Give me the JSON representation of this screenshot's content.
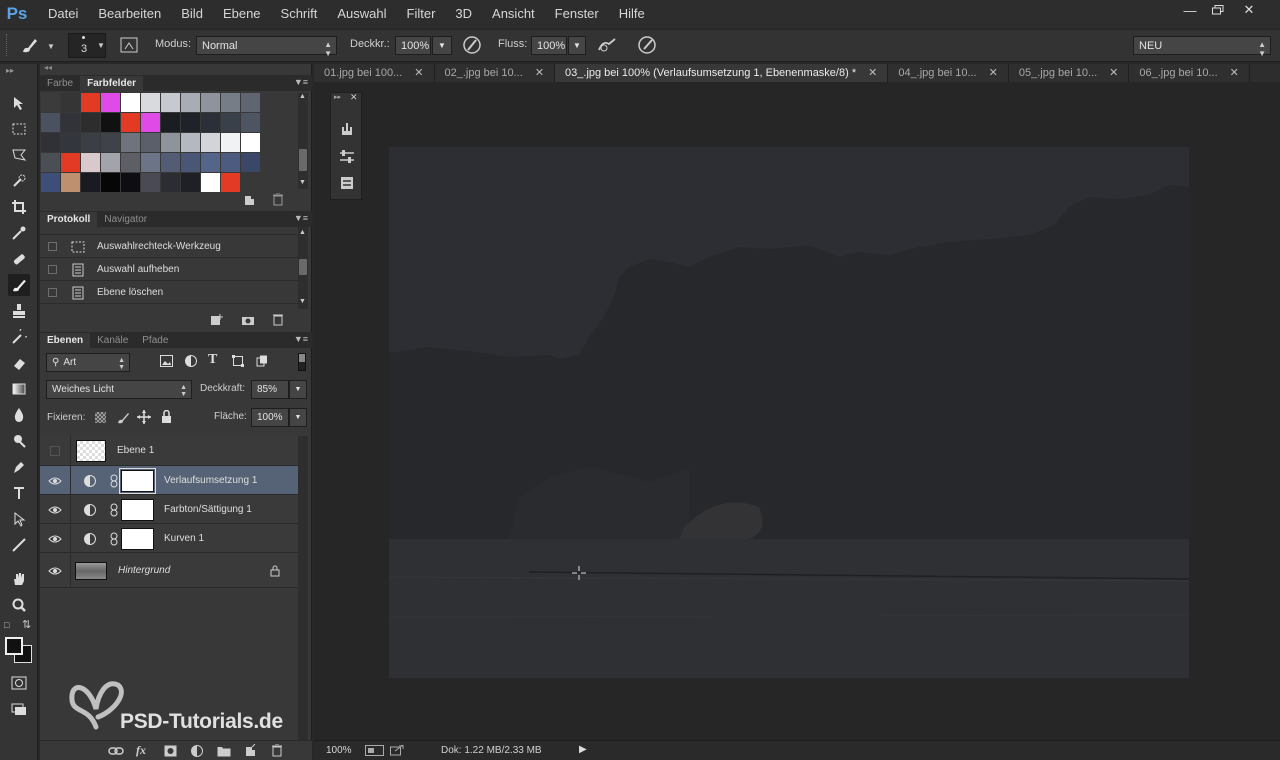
{
  "menubar": {
    "logo": "Ps",
    "items": [
      "Datei",
      "Bearbeiten",
      "Bild",
      "Ebene",
      "Schrift",
      "Auswahl",
      "Filter",
      "3D",
      "Ansicht",
      "Fenster",
      "Hilfe"
    ]
  },
  "options": {
    "brush_size": "3",
    "mode_label": "Modus:",
    "mode_value": "Normal",
    "opacity_label": "Deckkr.:",
    "opacity_value": "100%",
    "flow_label": "Fluss:",
    "flow_value": "100%",
    "workspace_value": "NEU"
  },
  "swatch_panel": {
    "tabs": [
      "Farbe",
      "Farbfelder"
    ],
    "active_tab": "Farbfelder",
    "swatches": [
      [
        "#3b3b3b",
        "#353535",
        "#e23a24",
        "#e04ae6",
        "#ffffff",
        "#d9dade",
        "#c6c9cf",
        "#a8acb4",
        "#8e939c",
        "#777d87",
        "#5f6671"
      ],
      [
        "#4a5261",
        "#313338",
        "#2d2d2d",
        "#111111",
        "#e23a24",
        "#e04ae6",
        "#1a1d22",
        "#1f2228",
        "#2b3038",
        "#3a404a",
        "#4d5462"
      ],
      [
        "#2f3137",
        "#33363c",
        "#3b3e45",
        "#3f4248",
        "#6f737c",
        "#5a5f69",
        "#8e939c",
        "#b4b8c0",
        "#d2d4da",
        "#f1f2f4",
        "#ffffff"
      ],
      [
        "#4c4e55",
        "#e23a24",
        "#d9c8cc",
        "#a3a3ab",
        "#5e5f66",
        "#6c7488",
        "#525c74",
        "#4a5676",
        "#556489",
        "#4c5b7f",
        "#3a4766"
      ],
      [
        "#3d4f79",
        "#bf9070",
        "#1a1b20",
        "#060606",
        "#0e0e12",
        "#4a4a55",
        "#2c2d33",
        "#1f2026",
        "#ffffff",
        "#e23a24",
        "#383838"
      ]
    ]
  },
  "history_panel": {
    "tabs": [
      "Protokoll",
      "Navigator"
    ],
    "active_tab": "Protokoll",
    "items": [
      {
        "label": "Auswahlrechteck-Werkzeug",
        "icon": "marquee-icon"
      },
      {
        "label": "Auswahl aufheben",
        "icon": "document-icon"
      },
      {
        "label": "Ebene löschen",
        "icon": "document-icon"
      }
    ]
  },
  "layers_panel": {
    "tabs": [
      "Ebenen",
      "Kanäle",
      "Pfade"
    ],
    "active_tab": "Ebenen",
    "filter_value": "Art",
    "blend_mode": "Weiches Licht",
    "opacity_label": "Deckkraft:",
    "opacity_value": "85%",
    "lock_label": "Fixieren:",
    "fill_label": "Fläche:",
    "fill_value": "100%",
    "layers": [
      {
        "name": "Ebene 1",
        "visible": false,
        "type": "pixel",
        "selected": false
      },
      {
        "name": "Verlaufsumsetzung 1",
        "visible": true,
        "type": "adjustment",
        "selected": true
      },
      {
        "name": "Farbton/Sättigung 1",
        "visible": true,
        "type": "adjustment",
        "selected": false
      },
      {
        "name": "Kurven 1",
        "visible": true,
        "type": "adjustment",
        "selected": false
      },
      {
        "name": "Hintergrund",
        "visible": true,
        "type": "background",
        "selected": false
      }
    ]
  },
  "doc_tabs": [
    {
      "label": "01.jpg bei 100...",
      "active": false
    },
    {
      "label": "02_.jpg bei 10...",
      "active": false
    },
    {
      "label": "03_.jpg bei 100% (Verlaufsumsetzung 1, Ebenenmaske/8) *",
      "active": true
    },
    {
      "label": "04_.jpg bei 10...",
      "active": false
    },
    {
      "label": "05_.jpg bei 10...",
      "active": false
    },
    {
      "label": "06_.jpg bei 10...",
      "active": false
    }
  ],
  "status": {
    "zoom": "100%",
    "doc": "Dok: 1.22 MB/2.33 MB"
  },
  "watermark": "PSD-Tutorials.de"
}
